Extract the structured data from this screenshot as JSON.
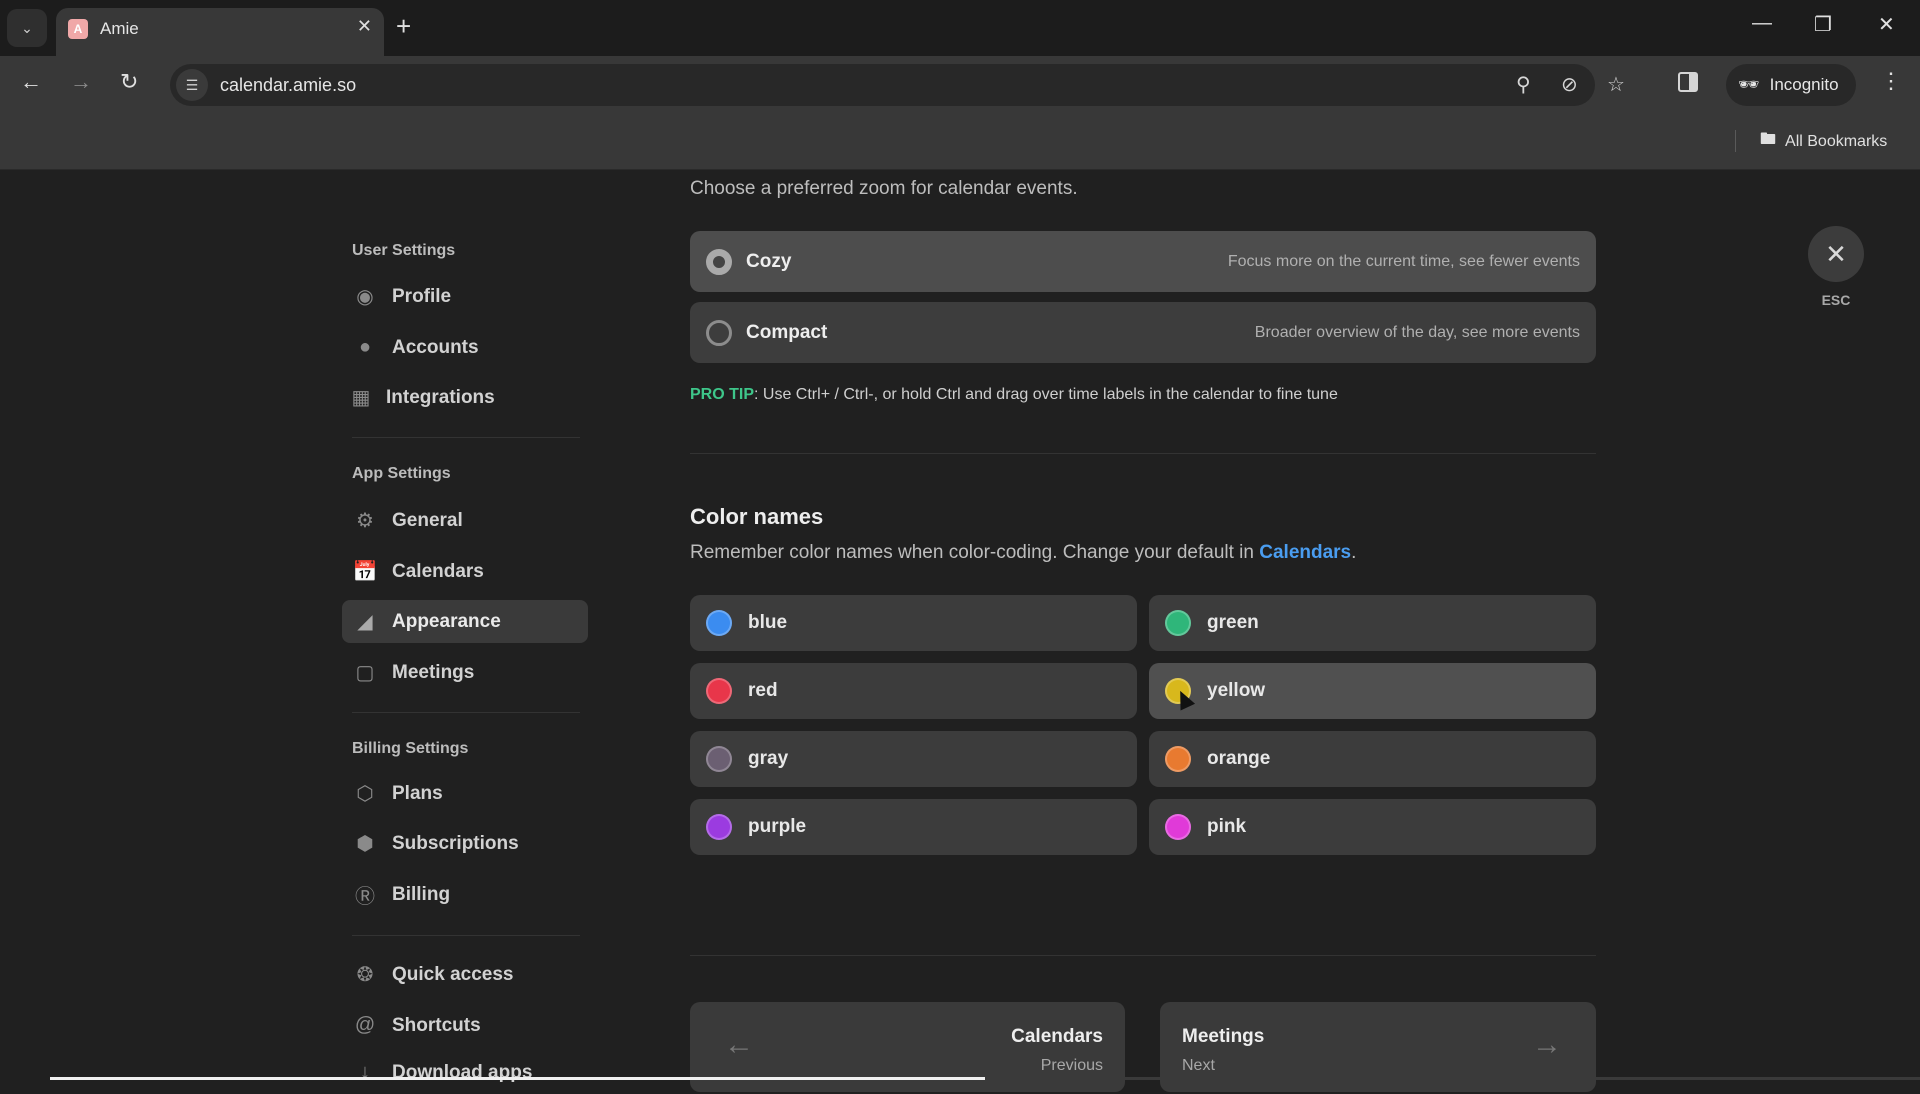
{
  "browser": {
    "tab_title": "Amie",
    "tab_favicon_letter": "A",
    "url": "calendar.amie.so",
    "incognito_label": "Incognito",
    "bookmarks_label": "All Bookmarks",
    "icons": {
      "tab_dropdown": "chevron-down-icon",
      "back": "arrow-left-icon",
      "forward": "arrow-right-icon",
      "reload": "reload-icon",
      "site_info": "tune-icon",
      "location": "location-pin-icon",
      "tracking": "eye-off-icon",
      "bookmark": "star-icon",
      "side_panel": "side-panel-icon",
      "menu": "kebab-menu-icon"
    }
  },
  "sidebar": {
    "sections": [
      {
        "header": "User Settings",
        "items": [
          {
            "label": "Profile",
            "icon": "person-icon"
          },
          {
            "label": "Accounts",
            "icon": "accounts-icon"
          },
          {
            "label": "Integrations",
            "icon": "grid-plus-icon"
          }
        ]
      },
      {
        "header": "App Settings",
        "items": [
          {
            "label": "General",
            "icon": "gear-icon"
          },
          {
            "label": "Calendars",
            "icon": "calendar-icon"
          },
          {
            "label": "Appearance",
            "icon": "appearance-icon",
            "active": true
          },
          {
            "label": "Meetings",
            "icon": "video-camera-icon"
          }
        ]
      },
      {
        "header": "Billing Settings",
        "items": [
          {
            "label": "Plans",
            "icon": "hexagon-icon"
          },
          {
            "label": "Subscriptions",
            "icon": "box-icon"
          },
          {
            "label": "Billing",
            "icon": "dollar-icon"
          }
        ]
      },
      {
        "header": "",
        "items": [
          {
            "label": "Quick access",
            "icon": "command-wheel-icon"
          },
          {
            "label": "Shortcuts",
            "icon": "at-icon"
          },
          {
            "label": "Download apps",
            "icon": "download-icon"
          }
        ]
      }
    ]
  },
  "zoom_section": {
    "subtitle": "Choose a preferred zoom for calendar events.",
    "options": [
      {
        "label": "Cozy",
        "description": "Focus more on the current time, see fewer events",
        "selected": true
      },
      {
        "label": "Compact",
        "description": "Broader overview of the day, see more events",
        "selected": false
      }
    ],
    "pro_tip_label": "PRO TIP",
    "pro_tip_text": ": Use Ctrl+ / Ctrl-, or hold Ctrl and drag over time labels in the calendar to fine tune"
  },
  "color_section": {
    "heading": "Color names",
    "description_prefix": "Remember color names when color-coding. Change your default in ",
    "description_link": "Calendars",
    "description_suffix": ".",
    "colors": [
      {
        "name": "blue",
        "hex": "#3b8cf0"
      },
      {
        "name": "green",
        "hex": "#2fb67a"
      },
      {
        "name": "red",
        "hex": "#e8364a"
      },
      {
        "name": "yellow",
        "hex": "#d8b81c",
        "hovered": true
      },
      {
        "name": "gray",
        "hex": "#6b5f72"
      },
      {
        "name": "orange",
        "hex": "#e87a30"
      },
      {
        "name": "purple",
        "hex": "#9b3be0"
      },
      {
        "name": "pink",
        "hex": "#e03ad8"
      }
    ]
  },
  "page_nav": {
    "previous": {
      "title": "Calendars",
      "subtitle": "Previous"
    },
    "next": {
      "title": "Meetings",
      "subtitle": "Next"
    }
  },
  "close": {
    "label": "ESC",
    "icon": "close-icon"
  },
  "video_progress": 0.5
}
